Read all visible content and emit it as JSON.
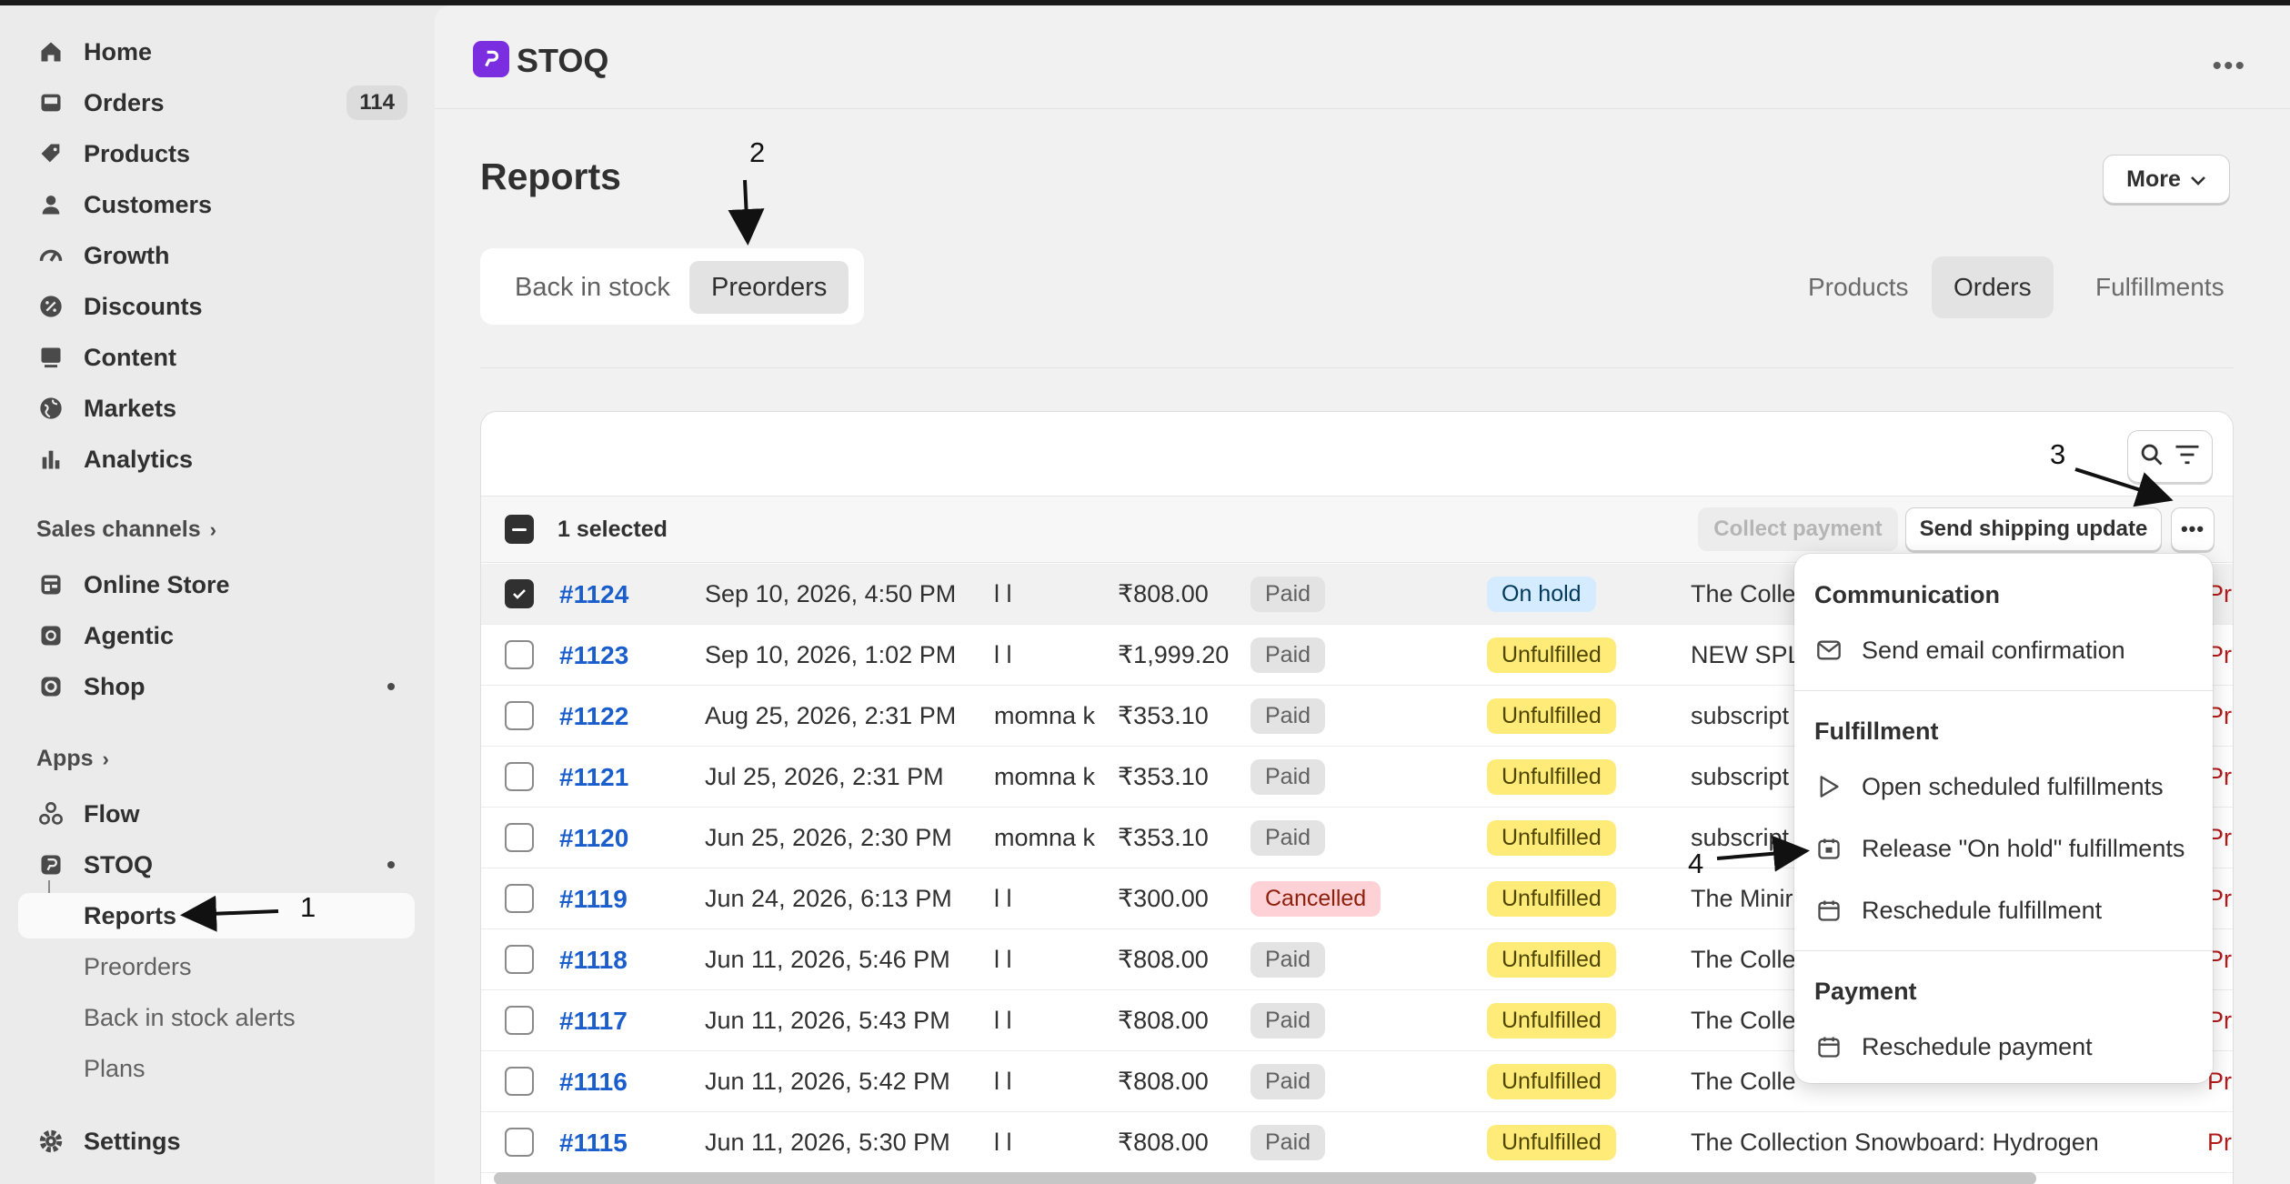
{
  "sidebar": {
    "items": [
      {
        "label": "Home",
        "icon": "home-icon"
      },
      {
        "label": "Orders",
        "icon": "inbox-icon",
        "badge": "114"
      },
      {
        "label": "Products",
        "icon": "tag-icon"
      },
      {
        "label": "Customers",
        "icon": "person-icon"
      },
      {
        "label": "Growth",
        "icon": "gauge-icon"
      },
      {
        "label": "Discounts",
        "icon": "discount-icon"
      },
      {
        "label": "Content",
        "icon": "content-icon"
      },
      {
        "label": "Markets",
        "icon": "globe-icon"
      },
      {
        "label": "Analytics",
        "icon": "bar-chart-icon"
      }
    ],
    "sales_channels_heading": "Sales channels",
    "channels": [
      {
        "label": "Online Store",
        "icon": "store-icon"
      },
      {
        "label": "Agentic",
        "icon": "agentic-icon"
      },
      {
        "label": "Shop",
        "icon": "shop-icon"
      }
    ],
    "apps_heading": "Apps",
    "apps": [
      {
        "label": "Flow",
        "icon": "flow-icon"
      },
      {
        "label": "STOQ",
        "icon": "stoq-icon"
      }
    ],
    "app_subitems": [
      "Reports",
      "Preorders",
      "Back in stock alerts",
      "Plans"
    ],
    "settings": "Settings"
  },
  "topbar": {
    "brand": "STOQ",
    "menu_dots": "•••"
  },
  "page": {
    "title": "Reports",
    "more_button": "More",
    "segment_tabs": [
      "Back in stock",
      "Preorders"
    ],
    "right_tabs": [
      "Products",
      "Orders",
      "Fulfillments"
    ]
  },
  "bulk": {
    "selected_text": "1 selected",
    "collect_payment": "Collect payment",
    "send_shipping_update": "Send shipping update"
  },
  "orders": [
    {
      "id": "#1124",
      "date": "Sep 10, 2026, 4:50 PM",
      "customer": "l l",
      "total": "₹808.00",
      "payment": "Paid",
      "fulfillment": "On hold",
      "product": "The Colle",
      "tail": "Pr",
      "selected": true
    },
    {
      "id": "#1123",
      "date": "Sep 10, 2026, 1:02 PM",
      "customer": "l l",
      "total": "₹1,999.20",
      "payment": "Paid",
      "fulfillment": "Unfulfilled",
      "product": "NEW SPL",
      "tail": "Pr",
      "selected": false
    },
    {
      "id": "#1122",
      "date": "Aug 25, 2026, 2:31 PM",
      "customer": "momna k",
      "total": "₹353.10",
      "payment": "Paid",
      "fulfillment": "Unfulfilled",
      "product": "subscript",
      "tail": "Pr",
      "selected": false
    },
    {
      "id": "#1121",
      "date": "Jul 25, 2026, 2:31 PM",
      "customer": "momna k",
      "total": "₹353.10",
      "payment": "Paid",
      "fulfillment": "Unfulfilled",
      "product": "subscript",
      "tail": "Pr",
      "selected": false
    },
    {
      "id": "#1120",
      "date": "Jun 25, 2026, 2:30 PM",
      "customer": "momna k",
      "total": "₹353.10",
      "payment": "Paid",
      "fulfillment": "Unfulfilled",
      "product": "subscript",
      "tail": "Pr",
      "selected": false
    },
    {
      "id": "#1119",
      "date": "Jun 24, 2026, 6:13 PM",
      "customer": "l l",
      "total": "₹300.00",
      "payment": "Cancelled",
      "fulfillment": "Unfulfilled",
      "product": "The Minir",
      "tail": "Pr",
      "selected": false
    },
    {
      "id": "#1118",
      "date": "Jun 11, 2026, 5:46 PM",
      "customer": "l l",
      "total": "₹808.00",
      "payment": "Paid",
      "fulfillment": "Unfulfilled",
      "product": "The Colle",
      "tail": "Pr",
      "selected": false
    },
    {
      "id": "#1117",
      "date": "Jun 11, 2026, 5:43 PM",
      "customer": "l l",
      "total": "₹808.00",
      "payment": "Paid",
      "fulfillment": "Unfulfilled",
      "product": "The Colle",
      "tail": "Pr",
      "selected": false
    },
    {
      "id": "#1116",
      "date": "Jun 11, 2026, 5:42 PM",
      "customer": "l l",
      "total": "₹808.00",
      "payment": "Paid",
      "fulfillment": "Unfulfilled",
      "product": "The Colle",
      "tail": "Pr",
      "selected": false
    },
    {
      "id": "#1115",
      "date": "Jun 11, 2026, 5:30 PM",
      "customer": "l l",
      "total": "₹808.00",
      "payment": "Paid",
      "fulfillment": "Unfulfilled",
      "product": "The Collection Snowboard: Hydrogen",
      "tail": "Pr",
      "selected": false
    }
  ],
  "menu": {
    "communication": "Communication",
    "send_email": "Send email confirmation",
    "fulfillment": "Fulfillment",
    "open_scheduled": "Open scheduled fulfillments",
    "release_hold": "Release \"On hold\" fulfillments",
    "reschedule_fulfillment": "Reschedule fulfillment",
    "payment": "Payment",
    "reschedule_payment": "Reschedule payment"
  },
  "annotations": [
    "1",
    "2",
    "3",
    "4"
  ],
  "colors": {
    "link": "#1a5dcc",
    "brand": "#7b2ee0",
    "unfulfilled": "#ffeb78",
    "on_hold": "#d5ebff",
    "cancelled": "#fed1d7",
    "chat": "#4a1170"
  }
}
